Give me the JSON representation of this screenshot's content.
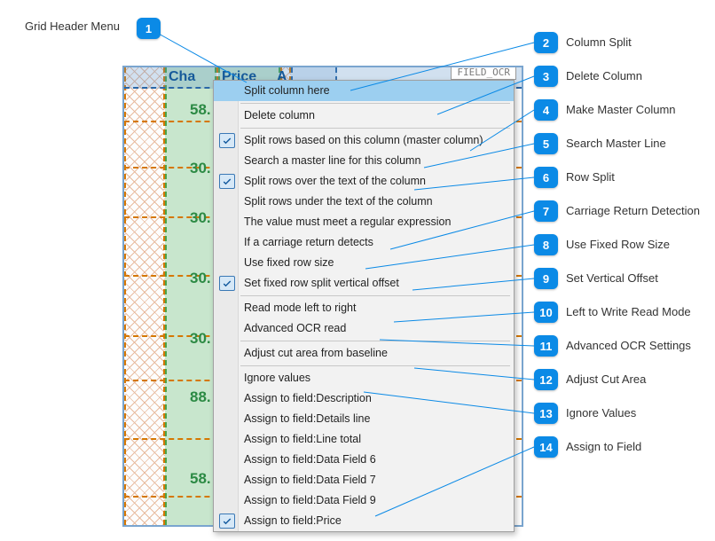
{
  "callouts": {
    "c1": "Grid Header Menu",
    "c2": "Column Split",
    "c3": "Delete Column",
    "c4": "Make Master Column",
    "c5": "Search Master Line",
    "c6": "Row Split",
    "c7": "Carriage Return Detection",
    "c8": "Use Fixed Row Size",
    "c9": "Set Vertical Offset",
    "c10": "Left to Write Read Mode",
    "c11": "Advanced OCR Settings",
    "c12": "Adjust Cut Area",
    "c13": "Ignore Values",
    "c14": "Assign to Field"
  },
  "header": {
    "cha": "Cha",
    "price": "Price",
    "a": "A",
    "ocr_field": "FIELD_OCR"
  },
  "grid_values": {
    "r1": "58.",
    "r2": "30.",
    "r3": "30.",
    "r4": "30.",
    "r5": "30.",
    "r6": "88.",
    "r7": "58."
  },
  "menu": {
    "m1": "Split column here",
    "m2": "Delete column",
    "m3": "Split rows based on this column (master column)",
    "m4": "Search a master line for this column",
    "m5": "Split rows over the text of the column",
    "m6": "Split rows under the text of the column",
    "m7": "The value must meet a regular expression",
    "m8": "If a carriage return detects",
    "m9": "Use fixed row size",
    "m10": "Set fixed row split vertical offset",
    "m11": "Read mode left to right",
    "m12": "Advanced OCR read",
    "m13": "Adjust cut area from baseline",
    "m14": "Ignore values",
    "m15": "Assign to field:Description",
    "m16": "Assign to field:Details line",
    "m17": "Assign to field:Line total",
    "m18": "Assign to field:Data Field 6",
    "m19": "Assign to field:Data Field 7",
    "m20": "Assign to field:Data Field 9",
    "m21": "Assign to field:Price"
  }
}
